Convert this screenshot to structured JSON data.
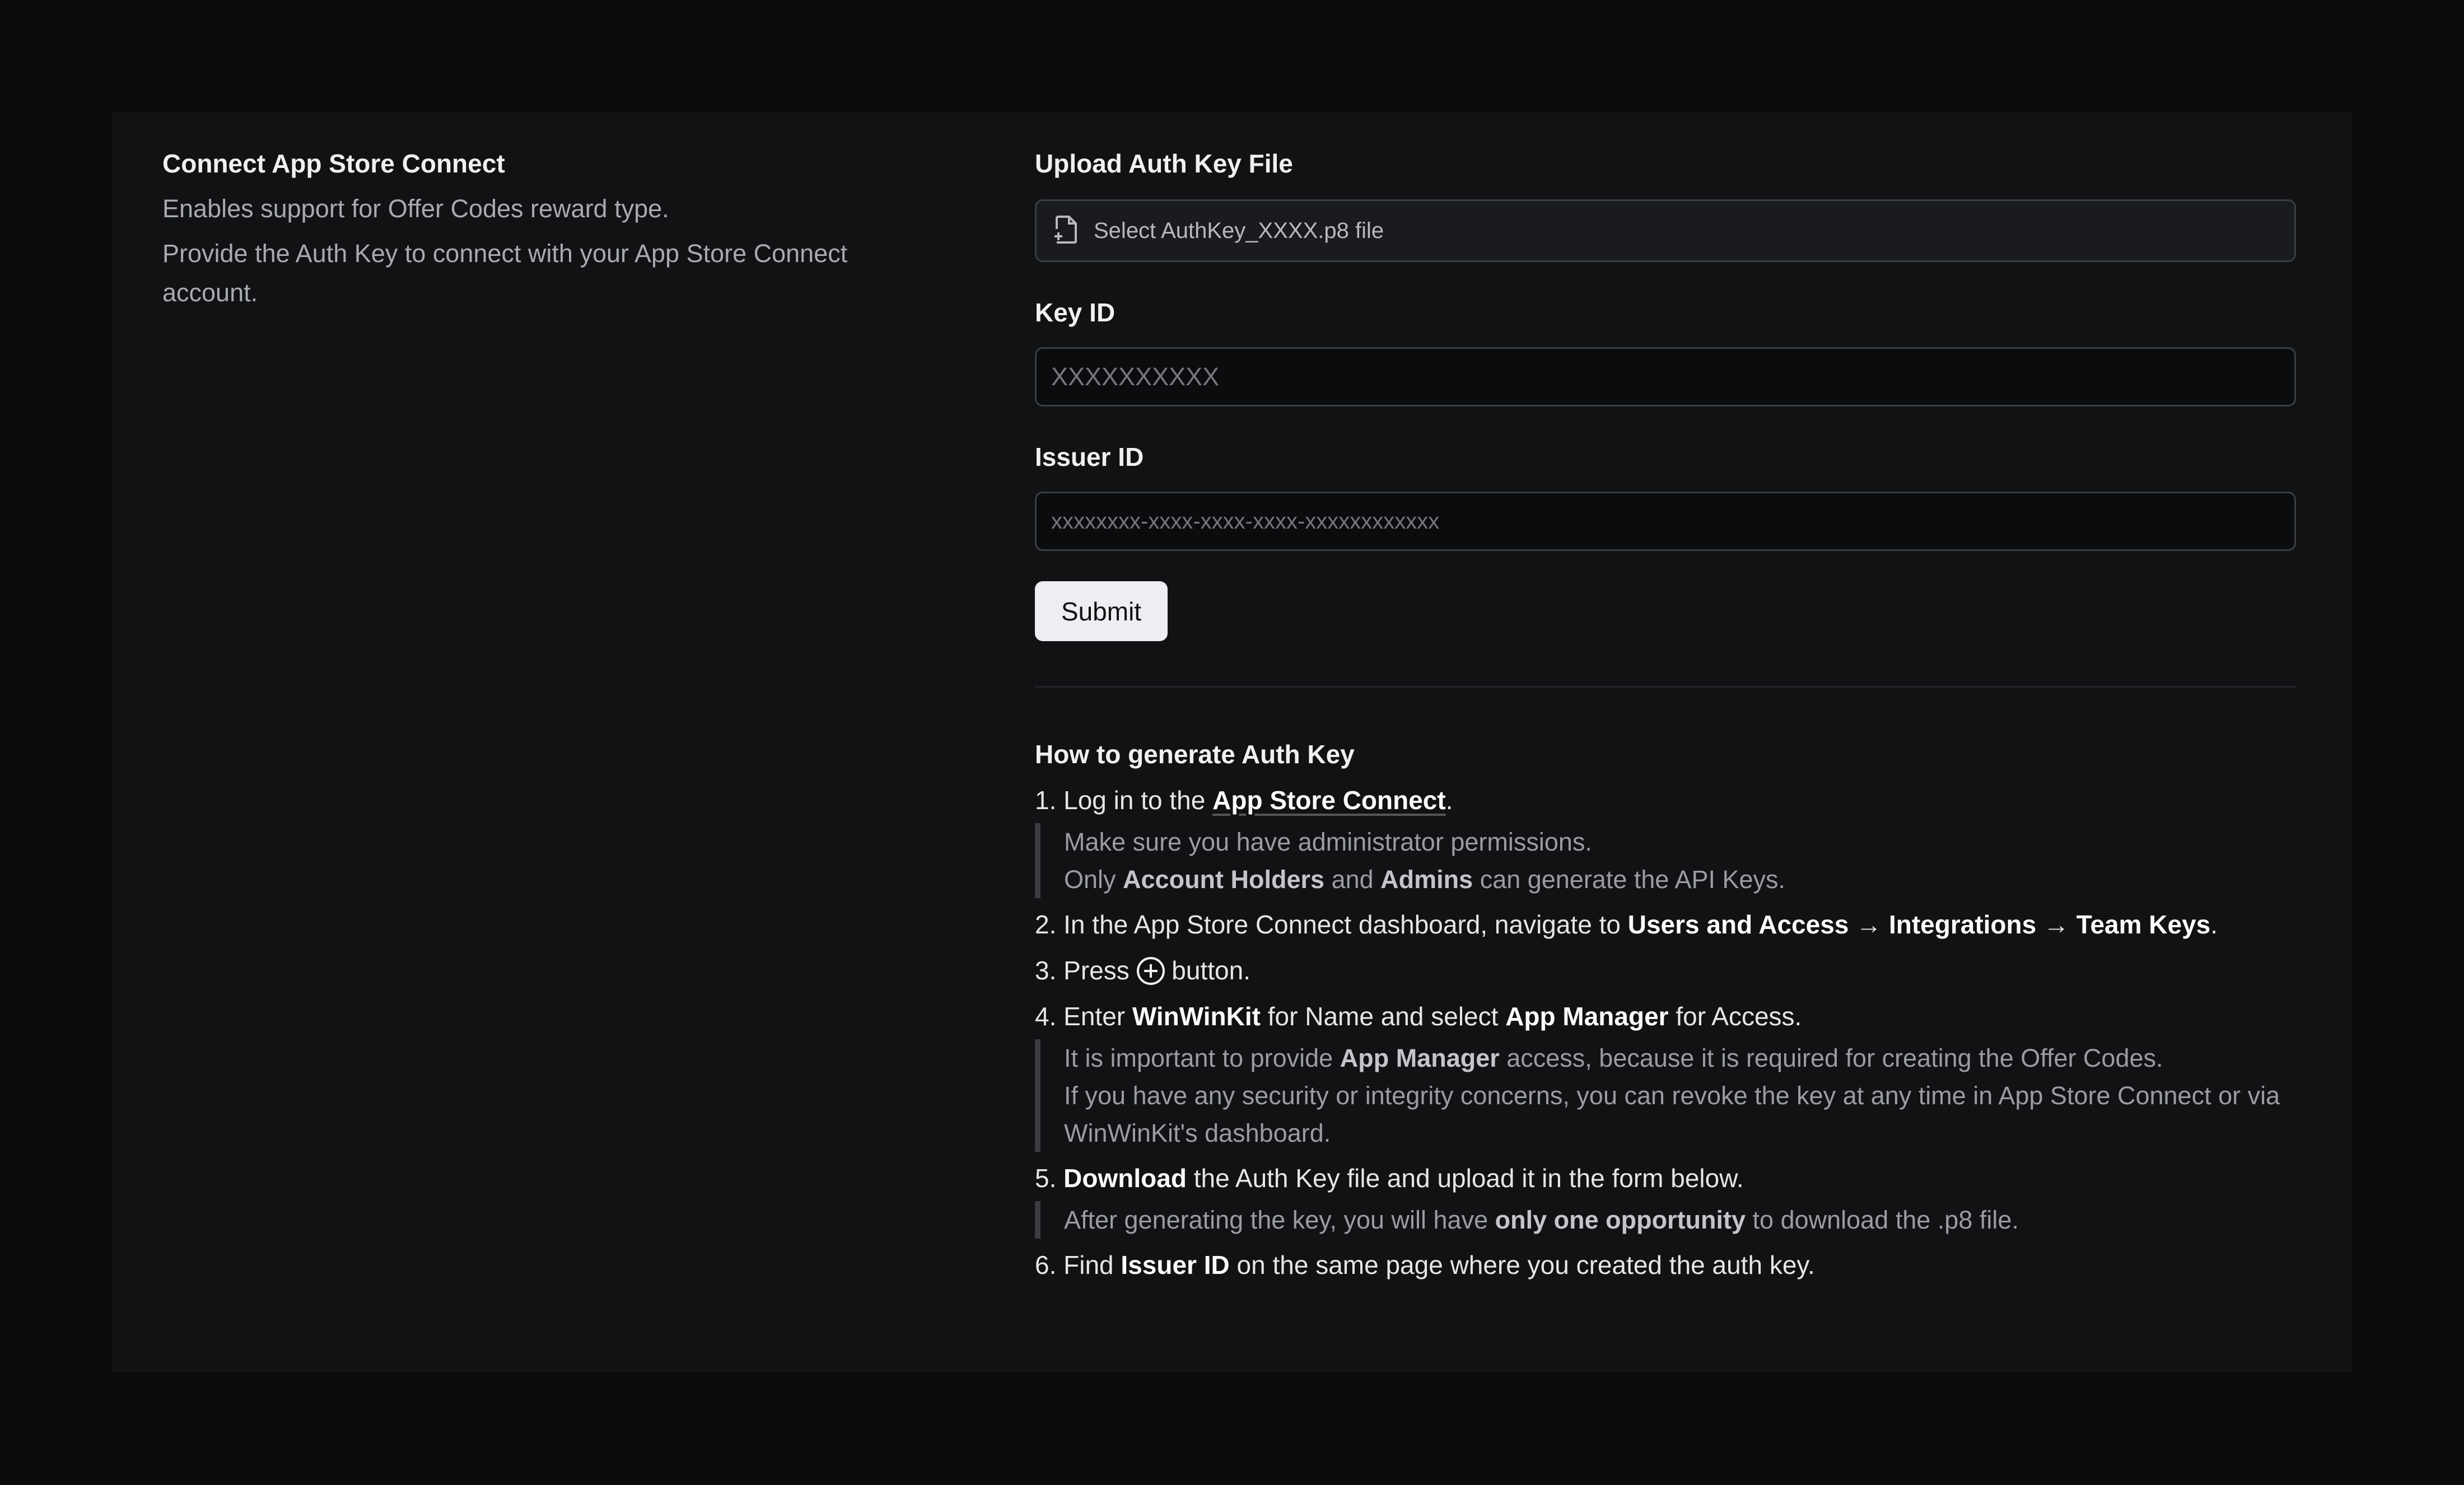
{
  "left": {
    "title": "Connect App Store Connect",
    "desc1": "Enables support for Offer Codes reward type.",
    "desc2": "Provide the Auth Key to connect with your App Store Connect account."
  },
  "form": {
    "upload_label": "Upload Auth Key File",
    "upload_placeholder": "Select AuthKey_XXXX.p8 file",
    "key_id_label": "Key ID",
    "key_id_placeholder": "XXXXXXXXXX",
    "issuer_id_label": "Issuer ID",
    "issuer_id_placeholder": "xxxxxxxx-xxxx-xxxx-xxxx-xxxxxxxxxxxx",
    "submit_label": "Submit"
  },
  "howto": {
    "title": "How to generate Auth Key",
    "steps": [
      {
        "parts": [
          {
            "t": "1. Log in to the "
          },
          {
            "t": "App Store Connect",
            "link": true
          },
          {
            "t": "."
          }
        ],
        "note": [
          [
            {
              "t": "Make sure you have administrator permissions."
            }
          ],
          [
            {
              "t": "Only "
            },
            {
              "t": "Account Holders",
              "b": true
            },
            {
              "t": " and "
            },
            {
              "t": "Admins",
              "b": true
            },
            {
              "t": " can generate the API Keys."
            }
          ]
        ]
      },
      {
        "parts": [
          {
            "t": "2. In the App Store Connect dashboard, navigate to "
          },
          {
            "t": "Users and Access",
            "b": true
          },
          {
            "t": " → "
          },
          {
            "t": "Integrations",
            "b": true
          },
          {
            "t": " → "
          },
          {
            "t": "Team Keys",
            "b": true
          },
          {
            "t": "."
          }
        ]
      },
      {
        "parts": [
          {
            "t": "3. Press "
          },
          {
            "icon": "plus-circle-icon"
          },
          {
            "t": " button."
          }
        ]
      },
      {
        "parts": [
          {
            "t": "4. Enter "
          },
          {
            "t": "WinWinKit",
            "b": true
          },
          {
            "t": " for Name and select "
          },
          {
            "t": "App Manager",
            "b": true
          },
          {
            "t": " for Access."
          }
        ],
        "note": [
          [
            {
              "t": "It is important to provide "
            },
            {
              "t": "App Manager",
              "b": true
            },
            {
              "t": " access, because it is required for creating the Offer Codes."
            }
          ],
          [
            {
              "t": "If you have any security or integrity concerns, you can revoke the key at any time in App Store Connect or via WinWinKit's dashboard."
            }
          ]
        ]
      },
      {
        "parts": [
          {
            "t": "5. "
          },
          {
            "t": "Download",
            "b": true
          },
          {
            "t": " the Auth Key file and upload it in the form below."
          }
        ],
        "note": [
          [
            {
              "t": "After generating the key, you will have "
            },
            {
              "t": "only one opportunity",
              "b": true
            },
            {
              "t": " to download the .p8 file."
            }
          ]
        ]
      },
      {
        "parts": [
          {
            "t": "6. Find "
          },
          {
            "t": "Issuer ID",
            "b": true
          },
          {
            "t": " on the same page where you created the auth key."
          }
        ]
      }
    ]
  }
}
